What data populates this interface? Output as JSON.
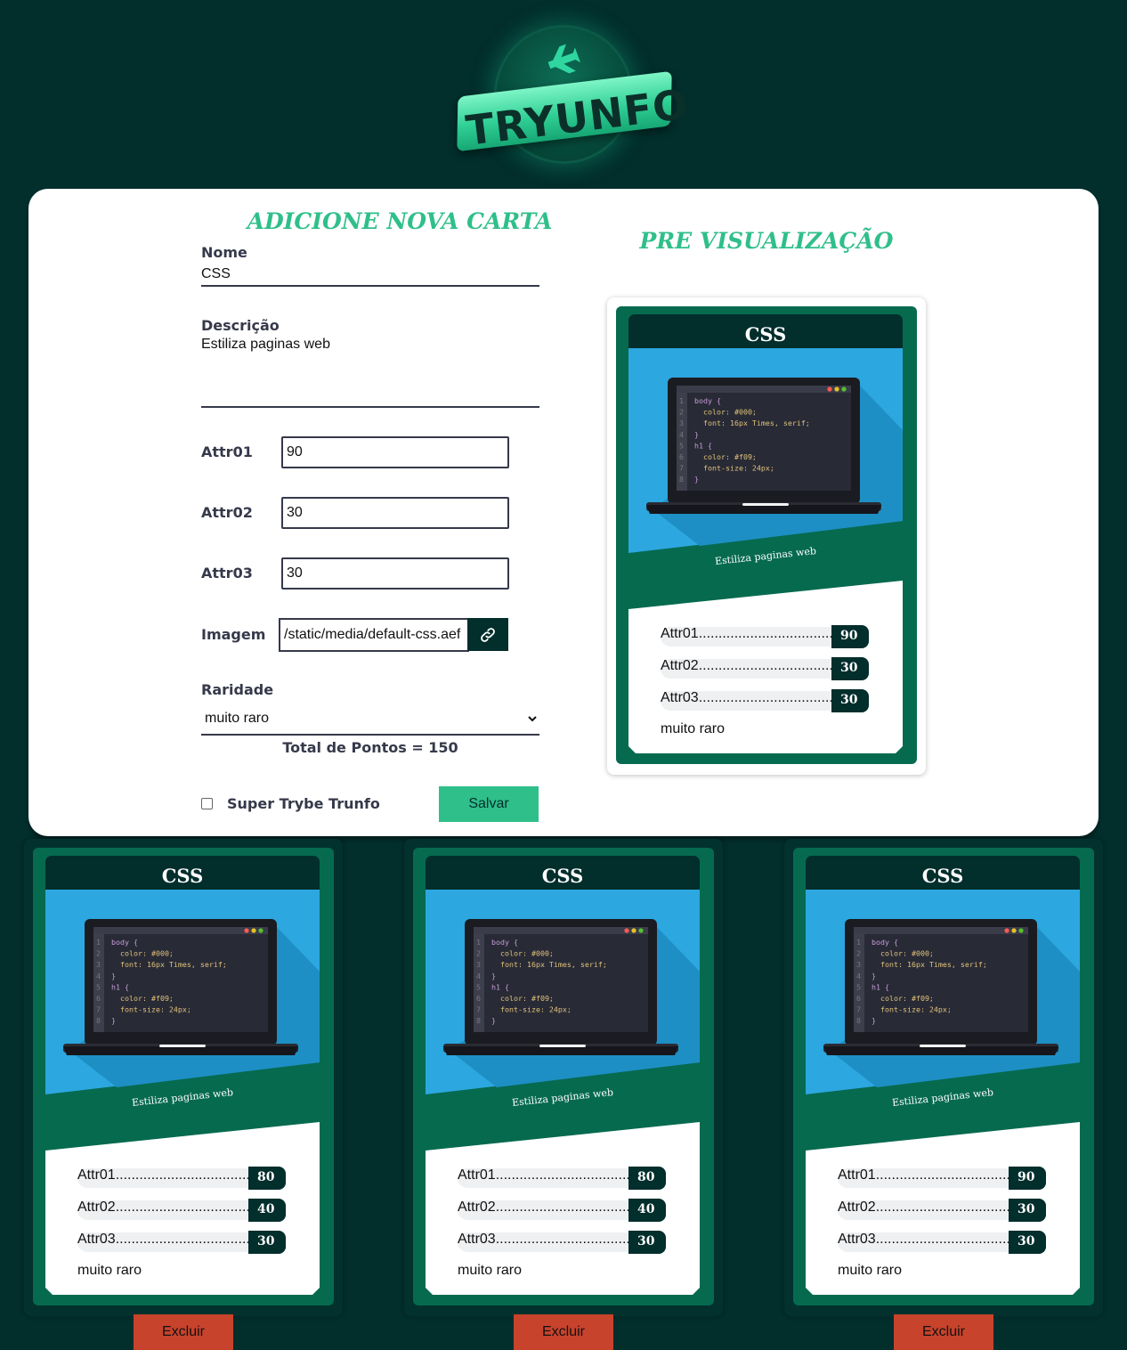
{
  "logo": {
    "text": "TRYUNFO"
  },
  "form": {
    "title": "ADICIONE NOVA CARTA",
    "name_label": "Nome",
    "name_value": "CSS",
    "desc_label": "Descrição",
    "desc_value": "Estiliza paginas web",
    "attr1_label": "Attr01",
    "attr1_value": "90",
    "attr2_label": "Attr02",
    "attr2_value": "30",
    "attr3_label": "Attr03",
    "attr3_value": "30",
    "image_label": "Imagem",
    "image_value": "/static/media/default-css.aef",
    "rarity_label": "Raridade",
    "rarity_value": "muito raro",
    "total": "Total de Pontos = 150",
    "trunfo_label": "Super Trybe Trunfo",
    "save_label": "Salvar"
  },
  "preview": {
    "title": "PRE VISUALIZAÇÃO",
    "card": {
      "name": "CSS",
      "desc": "Estiliza paginas web",
      "attrs": [
        {
          "name": "Attr01.....................................",
          "value": "90"
        },
        {
          "name": "Attr02.....................................",
          "value": "30"
        },
        {
          "name": "Attr03.....................................",
          "value": "30"
        }
      ],
      "rarity": "muito raro"
    }
  },
  "cards": [
    {
      "name": "CSS",
      "desc": "Estiliza paginas web",
      "attrs": [
        {
          "name": "Attr01.....................................",
          "value": "80"
        },
        {
          "name": "Attr02.....................................",
          "value": "40"
        },
        {
          "name": "Attr03.....................................",
          "value": "30"
        }
      ],
      "rarity": "muito raro",
      "delete_label": "Excluir"
    },
    {
      "name": "CSS",
      "desc": "Estiliza paginas web",
      "attrs": [
        {
          "name": "Attr01.....................................",
          "value": "80"
        },
        {
          "name": "Attr02.....................................",
          "value": "40"
        },
        {
          "name": "Attr03.....................................",
          "value": "30"
        }
      ],
      "rarity": "muito raro",
      "delete_label": "Excluir"
    },
    {
      "name": "CSS",
      "desc": "Estiliza paginas web",
      "attrs": [
        {
          "name": "Attr01.....................................",
          "value": "90"
        },
        {
          "name": "Attr02.....................................",
          "value": "30"
        },
        {
          "name": "Attr03.....................................",
          "value": "30"
        }
      ],
      "rarity": "muito raro",
      "delete_label": "Excluir"
    }
  ],
  "code_lines": [
    {
      "n": "1",
      "t": "body {"
    },
    {
      "n": "2",
      "t": "  color: #000;"
    },
    {
      "n": "3",
      "t": "  font: 16px Times, serif;"
    },
    {
      "n": "4",
      "t": "}"
    },
    {
      "n": "5",
      "t": "h1 {"
    },
    {
      "n": "6",
      "t": "  color: #f09;"
    },
    {
      "n": "7",
      "t": "  font-size: 24px;"
    },
    {
      "n": "8",
      "t": "}"
    }
  ],
  "icons": {
    "plane": "plane-icon",
    "link": "link-icon",
    "chevron": "chevron-down-icon"
  },
  "colors": {
    "background": "#022e2c",
    "accent": "#2fbf8a",
    "card": "#066a4f",
    "delete": "#c8432c",
    "sky": "#2ca7e0"
  }
}
